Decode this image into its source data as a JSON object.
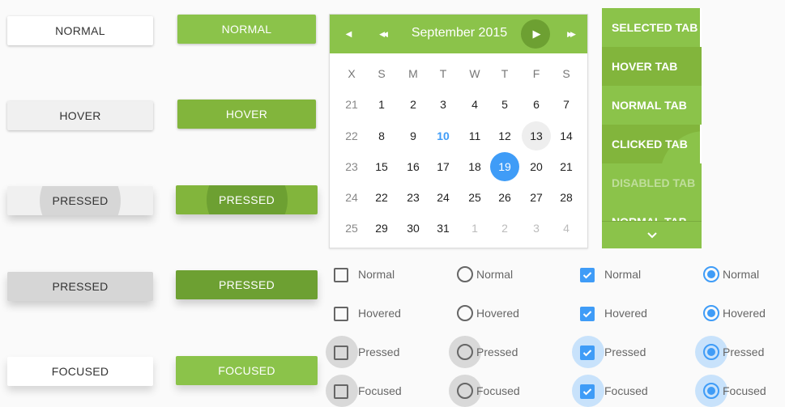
{
  "colors": {
    "accent_green": "#8bc34a",
    "green_hover": "#82b53c",
    "green_pressed": "#6da032",
    "accent_blue": "#3f9cf7"
  },
  "flat_buttons": [
    "NORMAL",
    "HOVER",
    "PRESSED",
    "PRESSED",
    "FOCUSED"
  ],
  "raised_buttons": [
    "NORMAL",
    "HOVER",
    "PRESSED",
    "PRESSED",
    "FOCUSED"
  ],
  "calendar": {
    "title": "September 2015",
    "icons": {
      "prev_month": "triangle-left-icon",
      "prev_year": "double-left-icon",
      "next_month": "triangle-right-icon",
      "next_year": "double-right-icon"
    },
    "weekday_headers": [
      "X",
      "S",
      "M",
      "T",
      "W",
      "T",
      "F",
      "S"
    ],
    "weeks": [
      {
        "week": "21",
        "days": [
          "1",
          "2",
          "3",
          "4",
          "5",
          "6",
          "7"
        ]
      },
      {
        "week": "22",
        "days": [
          "8",
          "9",
          "10",
          "11",
          "12",
          "13",
          "14"
        ]
      },
      {
        "week": "23",
        "days": [
          "15",
          "16",
          "17",
          "18",
          "19",
          "20",
          "21"
        ]
      },
      {
        "week": "24",
        "days": [
          "22",
          "23",
          "24",
          "25",
          "26",
          "27",
          "28"
        ]
      },
      {
        "week": "25",
        "days": [
          "29",
          "30",
          "31",
          "1",
          "2",
          "3",
          "4"
        ]
      }
    ],
    "today": "10",
    "hovered": "13",
    "selected": "19"
  },
  "tabs": [
    {
      "label": "SELECTED TAB",
      "state": "selected"
    },
    {
      "label": "HOVER TAB",
      "state": "hover"
    },
    {
      "label": "NORMAL TAB",
      "state": "normal"
    },
    {
      "label": "CLICKED TAB",
      "state": "clicked"
    },
    {
      "label": "DISABLED TAB",
      "state": "disabled"
    },
    {
      "label": "NORMAL TAB",
      "state": "normal"
    }
  ],
  "tabs_scroll_icon": "chevron-down-icon",
  "controls": {
    "states": [
      "Normal",
      "Hovered",
      "Pressed",
      "Focused"
    ],
    "columns": [
      {
        "type": "checkbox",
        "checked": false
      },
      {
        "type": "radio",
        "checked": false
      },
      {
        "type": "checkbox",
        "checked": true
      },
      {
        "type": "radio",
        "checked": true
      }
    ]
  }
}
